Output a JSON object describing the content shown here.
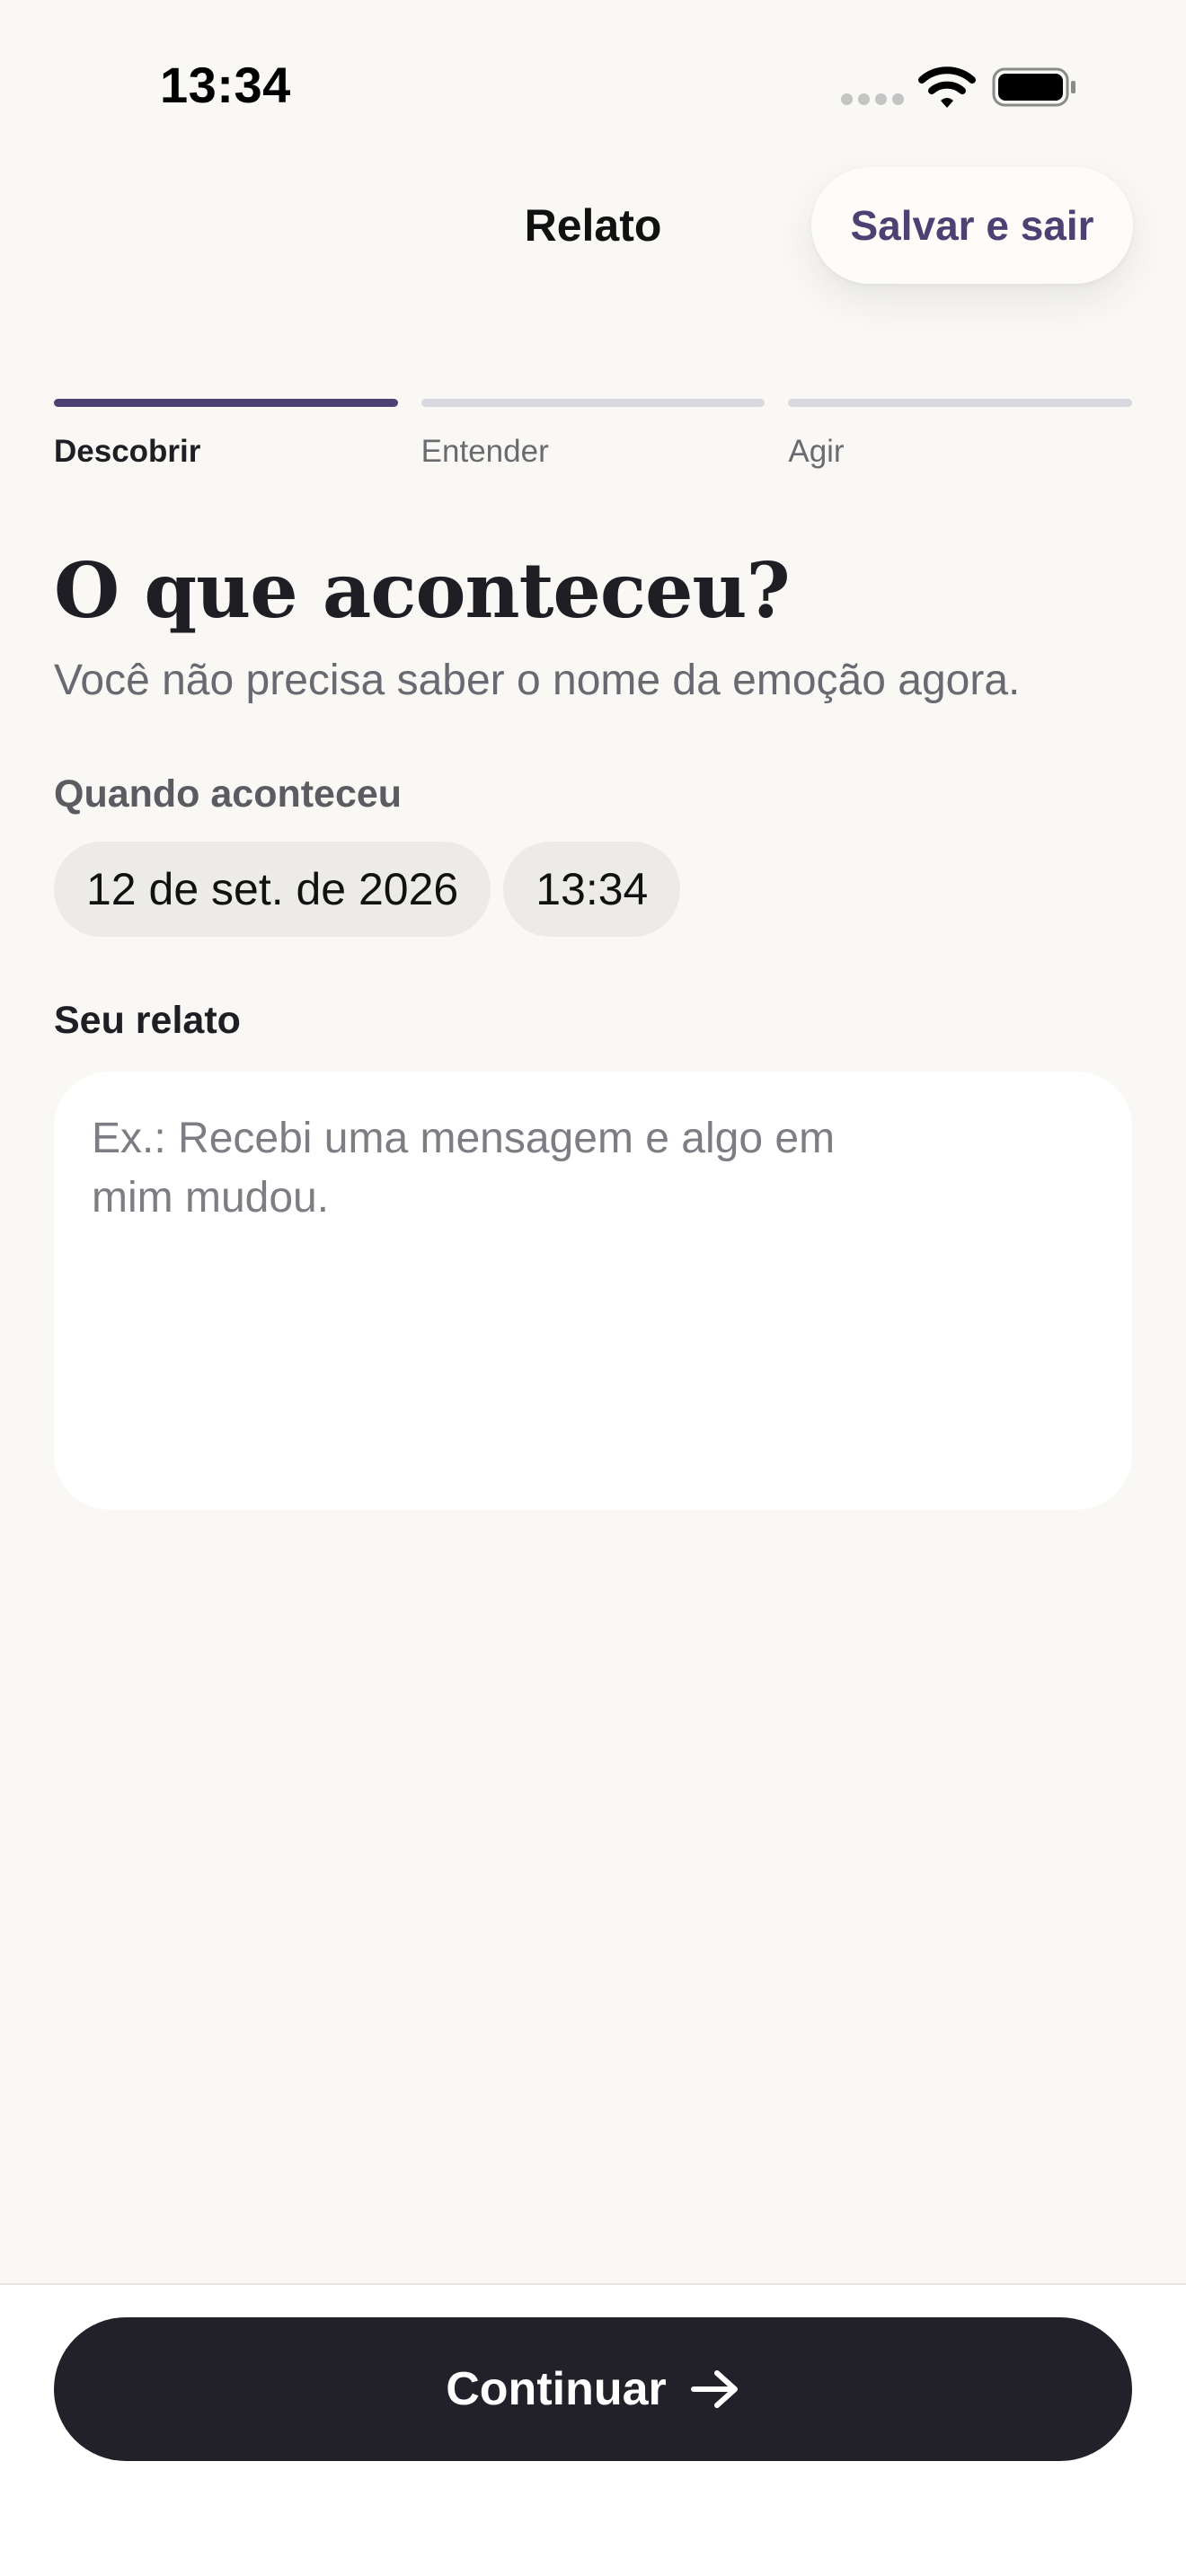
{
  "status_bar": {
    "time": "13:34",
    "icons": [
      "cellular-signal-icon",
      "wifi-icon",
      "battery-icon"
    ]
  },
  "nav": {
    "title": "Relato",
    "save_exit_label": "Salvar e sair"
  },
  "stepper": {
    "steps": [
      {
        "label": "Descobrir",
        "active": true
      },
      {
        "label": "Entender",
        "active": false
      },
      {
        "label": "Agir",
        "active": false
      }
    ]
  },
  "content": {
    "title": "O que aconteceu?",
    "subtitle": "Você não precisa saber o nome da emoção agora.",
    "when_label": "Quando aconteceu",
    "date_value": "12 de set. de 2026",
    "time_value": "13:34",
    "report_label": "Seu relato",
    "report_placeholder": "Ex.: Recebi uma mensagem e algo em\nmim mudou.",
    "report_value": ""
  },
  "footer": {
    "continue_label": "Continuar",
    "continue_icon": "arrow-right-icon"
  },
  "colors": {
    "background": "#F9F8F5",
    "accent": "#4C4172",
    "primary_button": "#22212A",
    "chip": "#ECEBE8"
  }
}
